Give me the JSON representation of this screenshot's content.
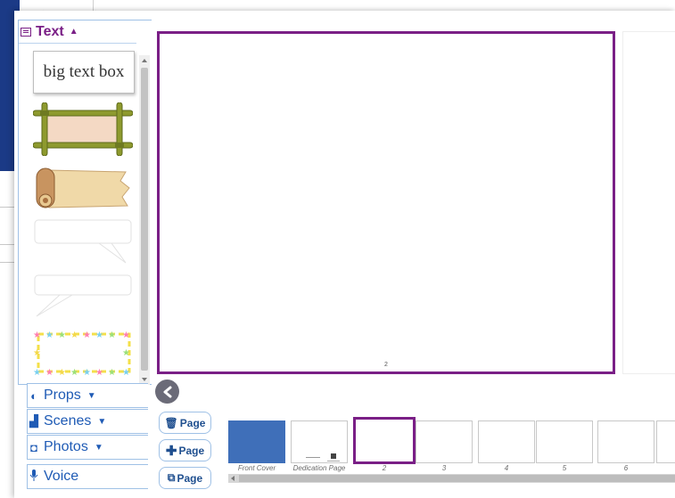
{
  "colors": {
    "accent": "#7a1f86",
    "link": "#1f5bb5",
    "panel_border": "#9fc1e6",
    "cover": "#3f6fb9"
  },
  "left_panel": {
    "text_section": {
      "label": "Text",
      "icon": "text-box-icon"
    },
    "big_text_box": "big text box",
    "thumbnails": [
      "bamboo-frame",
      "parchment-scroll",
      "speech-bubble",
      "speech-bubble-2",
      "star-frame"
    ]
  },
  "categories": [
    {
      "label": "Props",
      "icon": "props-icon"
    },
    {
      "label": "Scenes",
      "icon": "scenes-icon"
    },
    {
      "label": "Photos",
      "icon": "photos-icon"
    },
    {
      "label": "Voice",
      "icon": "microphone-icon"
    }
  ],
  "canvas": {
    "page_number": "2"
  },
  "page_buttons": [
    {
      "label": "Page",
      "icon": "trash-icon"
    },
    {
      "label": "Page",
      "icon": "plus-icon"
    },
    {
      "label": "Page",
      "icon": "duplicate-icon"
    }
  ],
  "filmstrip": {
    "selected_index": 2,
    "pages": [
      {
        "caption": "Front Cover"
      },
      {
        "caption": "Dedication Page"
      },
      {
        "caption": "2"
      },
      {
        "caption": "3"
      },
      {
        "caption": "4"
      },
      {
        "caption": "5"
      },
      {
        "caption": "6"
      }
    ]
  }
}
